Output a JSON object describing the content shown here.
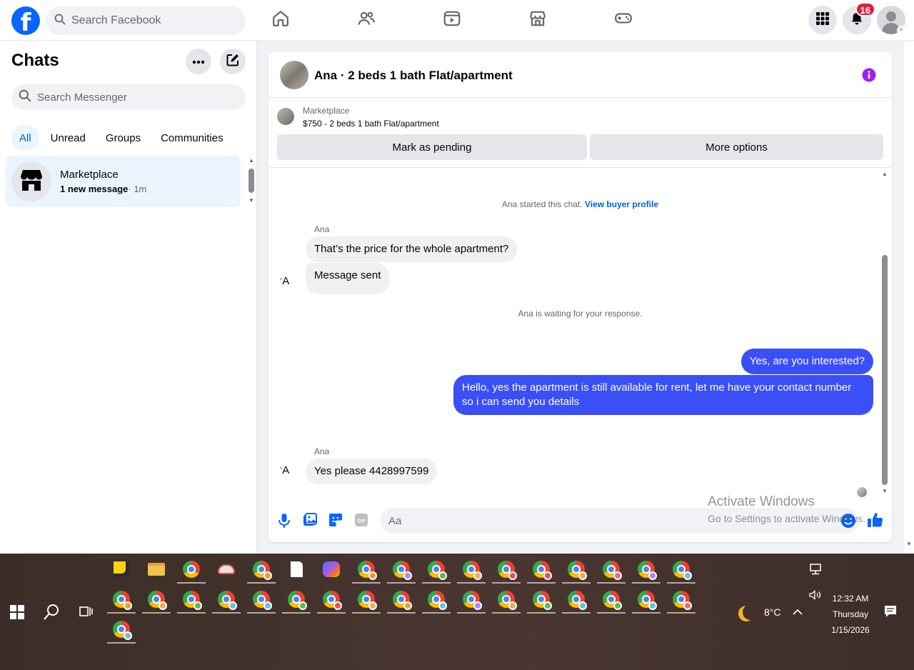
{
  "topnav": {
    "logo_letter": "f",
    "search_placeholder": "Search Facebook",
    "notification_count": "16",
    "nav_icons": [
      "home-icon",
      "friends-icon",
      "video-icon",
      "marketplace-icon",
      "gaming-icon"
    ]
  },
  "chats": {
    "title": "Chats",
    "search_placeholder": "Search Messenger",
    "filters": [
      "All",
      "Unread",
      "Groups",
      "Communities"
    ],
    "active_filter": "All",
    "items": [
      {
        "name": "Marketplace",
        "preview": "1 new message",
        "time": "· 1m"
      }
    ]
  },
  "conversation": {
    "title": "Ana · 2 beds 1 bath Flat/apartment",
    "listing": {
      "source": "Marketplace",
      "price_title": "$750 - 2 beds 1 bath Flat/apartment",
      "pending_label": "Mark as pending",
      "more_label": "More options"
    },
    "started_text": "Ana started this chat.",
    "buyer_profile_link": "View buyer profile",
    "sender_name": "Ana",
    "avatar_alt": "A",
    "incoming_1": "That’s the price for the whole apartment?",
    "incoming_2": "Message sent",
    "waiting_text": "Ana is waiting for your response.",
    "outgoing_1": "Yes, are you interested?",
    "outgoing_2": "Hello, yes the apartment is still available for rent, let me have your contact number so i can send you details",
    "incoming_3": "Yes please 4428997599",
    "composer_placeholder": "Aa",
    "accent_color": "#3b4ff7"
  },
  "watermark": {
    "line1": "Activate Windows",
    "line2": "Go to Settings to activate Windows."
  },
  "taskbar": {
    "weather_temp": "8°C",
    "time": "12:32 AM",
    "day": "Thursday",
    "date": "1/15/2026"
  }
}
